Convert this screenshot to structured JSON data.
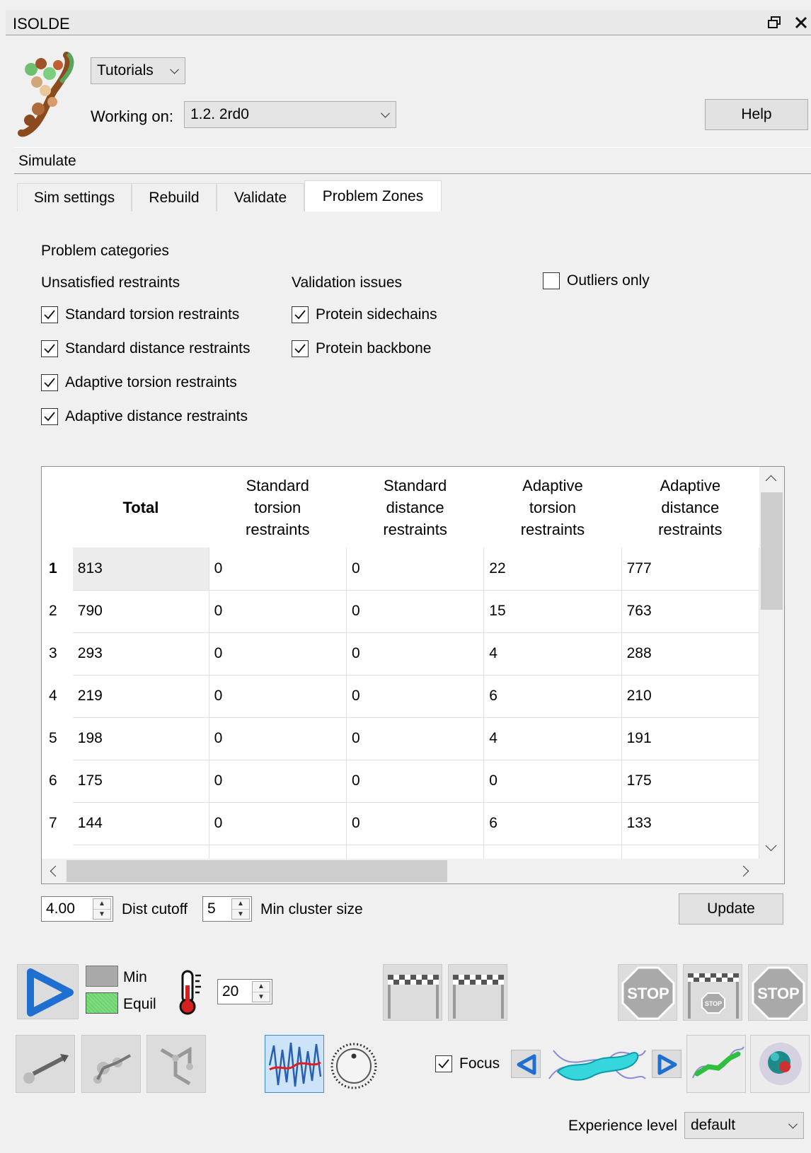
{
  "window": {
    "title": "ISOLDE"
  },
  "header": {
    "tutorials_label": "Tutorials",
    "working_on_label": "Working on:",
    "working_on_value": "1.2. 2rd0",
    "help_label": "Help"
  },
  "section": {
    "title": "Simulate"
  },
  "tabs": [
    {
      "label": "Sim settings"
    },
    {
      "label": "Rebuild"
    },
    {
      "label": "Validate"
    },
    {
      "label": "Problem Zones"
    }
  ],
  "problem_zones": {
    "categories_label": "Problem categories",
    "unsatisfied_label": "Unsatisfied restraints",
    "validation_label": "Validation issues",
    "outliers_only": {
      "label": "Outliers only",
      "checked": false
    },
    "restraints": [
      {
        "label": "Standard torsion restraints",
        "checked": true
      },
      {
        "label": "Standard distance restraints",
        "checked": true
      },
      {
        "label": "Adaptive torsion restraints",
        "checked": true
      },
      {
        "label": "Adaptive distance restraints",
        "checked": true
      }
    ],
    "validation": [
      {
        "label": "Protein sidechains",
        "checked": true
      },
      {
        "label": "Protein backbone",
        "checked": true
      }
    ]
  },
  "table": {
    "columns": [
      {
        "lines": [
          "Total"
        ]
      },
      {
        "lines": [
          "Standard",
          "torsion",
          "restraints"
        ]
      },
      {
        "lines": [
          "Standard",
          "distance",
          "restraints"
        ]
      },
      {
        "lines": [
          "Adaptive",
          "torsion",
          "restraints"
        ]
      },
      {
        "lines": [
          "Adaptive",
          "distance",
          "restraints"
        ]
      }
    ],
    "rows": [
      {
        "id": "1",
        "cells": [
          "813",
          "0",
          "0",
          "22",
          "777"
        ]
      },
      {
        "id": "2",
        "cells": [
          "790",
          "0",
          "0",
          "15",
          "763"
        ]
      },
      {
        "id": "3",
        "cells": [
          "293",
          "0",
          "0",
          "4",
          "288"
        ]
      },
      {
        "id": "4",
        "cells": [
          "219",
          "0",
          "0",
          "6",
          "210"
        ]
      },
      {
        "id": "5",
        "cells": [
          "198",
          "0",
          "0",
          "4",
          "191"
        ]
      },
      {
        "id": "6",
        "cells": [
          "175",
          "0",
          "0",
          "0",
          "175"
        ]
      },
      {
        "id": "7",
        "cells": [
          "144",
          "0",
          "0",
          "6",
          "133"
        ]
      }
    ]
  },
  "controls": {
    "dist_cutoff_value": "4.00",
    "dist_cutoff_label": "Dist cutoff",
    "min_cluster_value": "5",
    "min_cluster_label": "Min cluster size",
    "update_label": "Update"
  },
  "sim_toolbar": {
    "min_label": "Min",
    "equil_label": "Equil",
    "temperature_value": "20",
    "stop_text": "STOP",
    "focus_label": "Focus",
    "focus_checked": true
  },
  "experience": {
    "label": "Experience level",
    "value": "default"
  },
  "colors": {
    "play_blue": "#1f6fd1",
    "equil_green": "#7be07b",
    "stop_gray": "#a9a9a9",
    "selected_icon_bg": "#cce4f7"
  }
}
